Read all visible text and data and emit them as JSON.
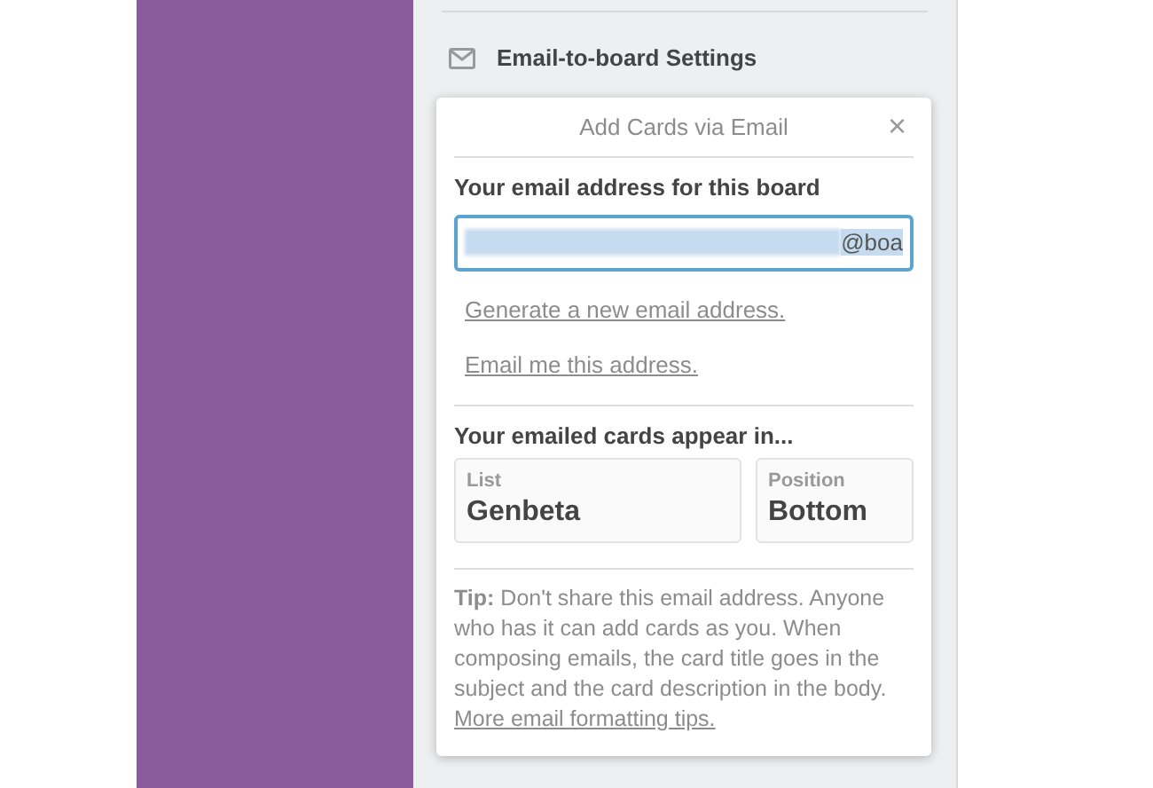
{
  "sidebar": {
    "section_title": "Email-to-board Settings"
  },
  "popover": {
    "title": "Add Cards via Email",
    "close": "×",
    "address_label": "Your email address for this board",
    "address_value": "@boa",
    "links": [
      "Generate a new email address.",
      "Email me this address."
    ],
    "destination_label": "Your emailed cards appear in...",
    "selects": [
      {
        "label": "List",
        "value": "Genbeta"
      },
      {
        "label": "Position",
        "value": "Bottom"
      }
    ],
    "tip": "**Tip:** Don't share this email address. Anyone who has it can add cards as you. When composing emails, the card title goes in the subject and the card description in the body.",
    "tip_link": "More email formatting tips."
  }
}
